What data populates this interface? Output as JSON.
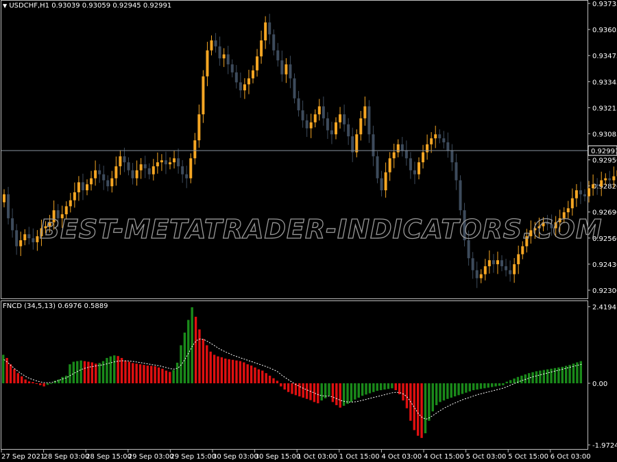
{
  "price_panel": {
    "symbol": "USDCHF,H1",
    "ohlc": [
      "0.93039",
      "0.93059",
      "0.92945",
      "0.92991"
    ],
    "current_price_label": "0.92991",
    "y_ticks": [
      "0.93735",
      "0.93605",
      "0.93475",
      "0.93345",
      "0.93215",
      "0.93085",
      "0.92950",
      "0.92820",
      "0.92690",
      "0.92560",
      "0.92430",
      "0.92300"
    ]
  },
  "indicator_panel": {
    "name": "FNCD (34,5,13)",
    "values": [
      "0.6976",
      "0.5889"
    ],
    "y_ticks": [
      "2.4194",
      "0.00",
      "-1.9724"
    ]
  },
  "time_axis": [
    "27 Sep 2021",
    "28 Sep 03:00",
    "28 Sep 15:00",
    "29 Sep 03:00",
    "29 Sep 15:00",
    "30 Sep 03:00",
    "30 Sep 15:00",
    "1 Oct 03:00",
    "1 Oct 15:00",
    "4 Oct 03:00",
    "4 Oct 15:00",
    "5 Oct 03:00",
    "5 Oct 15:00",
    "6 Oct 03:00"
  ],
  "watermark": "BEST-METATRADER-INDICATORS.COM",
  "colors": {
    "background": "#000000",
    "bull_candle": "#f5a623",
    "bear_candle": "#3d4b5c",
    "hist_up": "#1a8a1a",
    "hist_down": "#e01010",
    "signal_line": "#ffffff",
    "axis_line": "#c0c0c0",
    "price_line": "#8a94a0"
  },
  "chart_data": [
    {
      "type": "candlestick",
      "title": "USDCHF,H1",
      "ylim": [
        0.9224,
        0.9375
      ],
      "close": [
        0.9278,
        0.9266,
        0.926,
        0.9252,
        0.9255,
        0.9258,
        0.9256,
        0.9254,
        0.9257,
        0.9261,
        0.9262,
        0.9264,
        0.927,
        0.9266,
        0.9268,
        0.9272,
        0.9275,
        0.9279,
        0.9284,
        0.928,
        0.9283,
        0.9286,
        0.929,
        0.9288,
        0.9285,
        0.9282,
        0.9286,
        0.9292,
        0.9297,
        0.9294,
        0.929,
        0.9286,
        0.929,
        0.9293,
        0.9291,
        0.9288,
        0.9292,
        0.9294,
        0.9295,
        0.9293,
        0.9294,
        0.9296,
        0.9292,
        0.9288,
        0.9286,
        0.9296,
        0.9305,
        0.9318,
        0.9337,
        0.935,
        0.9355,
        0.9352,
        0.9346,
        0.9348,
        0.9343,
        0.9339,
        0.9334,
        0.933,
        0.9333,
        0.9336,
        0.934,
        0.9347,
        0.9355,
        0.9364,
        0.9358,
        0.935,
        0.9345,
        0.9338,
        0.9343,
        0.9336,
        0.9326,
        0.932,
        0.9315,
        0.9311,
        0.9314,
        0.9318,
        0.9322,
        0.9316,
        0.931,
        0.9308,
        0.9314,
        0.9318,
        0.9313,
        0.9307,
        0.9299,
        0.9308,
        0.9316,
        0.9322,
        0.9308,
        0.9297,
        0.9286,
        0.928,
        0.9289,
        0.9296,
        0.9299,
        0.9303,
        0.93,
        0.9296,
        0.929,
        0.9288,
        0.9294,
        0.9299,
        0.9303,
        0.9306,
        0.9308,
        0.9306,
        0.9304,
        0.93,
        0.9294,
        0.9285,
        0.927,
        0.9255,
        0.9246,
        0.924,
        0.9236,
        0.9238,
        0.9242,
        0.9245,
        0.9243,
        0.9245,
        0.9242,
        0.924,
        0.9238,
        0.9243,
        0.9248,
        0.9252,
        0.9257,
        0.926,
        0.9261,
        0.9262,
        0.9264,
        0.9263,
        0.9261,
        0.9264,
        0.9266,
        0.9269,
        0.9271,
        0.9276,
        0.928,
        0.9278,
        0.9277,
        0.9281,
        0.9283,
        0.9282,
        0.9285,
        0.9286,
        0.9285,
        0.9287,
        0.929,
        0.9293,
        0.9297,
        0.93,
        0.9299
      ]
    },
    {
      "type": "bar",
      "title": "FNCD (34,5,13)",
      "ylim": [
        -1.9724,
        2.4194
      ],
      "series": [
        {
          "values": [
            0.9,
            0.8,
            0.6,
            0.45,
            0.32,
            0.22,
            0.12,
            0.06,
            0.04,
            -0.02,
            -0.06,
            -0.1,
            -0.05,
            0.0,
            0.08,
            0.12,
            0.2,
            0.24,
            0.6,
            0.68,
            0.7,
            0.72,
            0.7,
            0.68,
            0.66,
            0.62,
            0.64,
            0.7,
            0.8,
            0.85,
            0.88,
            0.86,
            0.8,
            0.72,
            0.68,
            0.64,
            0.62,
            0.6,
            0.58,
            0.56,
            0.55,
            0.54,
            0.5,
            0.46,
            0.4,
            0.36,
            0.42,
            0.65,
            1.2,
            1.6,
            2.0,
            2.4,
            2.1,
            1.7,
            1.4,
            1.2,
            1.0,
            0.9,
            0.85,
            0.82,
            0.78,
            0.76,
            0.74,
            0.72,
            0.7,
            0.66,
            0.6,
            0.56,
            0.5,
            0.44,
            0.4,
            0.32,
            0.24,
            0.16,
            0.08,
            -0.1,
            -0.2,
            -0.28,
            -0.34,
            -0.38,
            -0.42,
            -0.46,
            -0.5,
            -0.54,
            -0.6,
            -0.64,
            -0.55,
            -0.48,
            -0.4,
            -0.6,
            -0.7,
            -0.78,
            -0.72,
            -0.66,
            -0.6,
            -0.52,
            -0.46,
            -0.4,
            -0.36,
            -0.32,
            -0.28,
            -0.24,
            -0.22,
            -0.2,
            -0.18,
            -0.16,
            -0.22,
            -0.35,
            -0.55,
            -0.8,
            -1.2,
            -1.5,
            -1.68,
            -1.75,
            -1.6,
            -1.2,
            -0.9,
            -0.7,
            -0.6,
            -0.55,
            -0.5,
            -0.46,
            -0.42,
            -0.38,
            -0.34,
            -0.3,
            -0.26,
            -0.22,
            -0.2,
            -0.18,
            -0.16,
            -0.14,
            -0.12,
            -0.1,
            -0.08,
            -0.06,
            0.05,
            0.1,
            0.15,
            0.2,
            0.24,
            0.28,
            0.32,
            0.35,
            0.38,
            0.4,
            0.42,
            0.44,
            0.46,
            0.48,
            0.5,
            0.52,
            0.55,
            0.58,
            0.62,
            0.66,
            0.7
          ]
        },
        {
          "values": [
            0.75,
            0.66,
            0.55,
            0.45,
            0.36,
            0.28,
            0.21,
            0.15,
            0.11,
            0.07,
            0.04,
            0.02,
            0.02,
            0.03,
            0.06,
            0.1,
            0.14,
            0.18,
            0.25,
            0.32,
            0.38,
            0.44,
            0.48,
            0.51,
            0.53,
            0.55,
            0.57,
            0.59,
            0.62,
            0.65,
            0.68,
            0.7,
            0.71,
            0.71,
            0.7,
            0.69,
            0.67,
            0.65,
            0.63,
            0.61,
            0.59,
            0.57,
            0.55,
            0.52,
            0.49,
            0.46,
            0.45,
            0.48,
            0.6,
            0.78,
            0.98,
            1.2,
            1.35,
            1.4,
            1.38,
            1.32,
            1.25,
            1.18,
            1.1,
            1.04,
            0.98,
            0.93,
            0.88,
            0.84,
            0.8,
            0.76,
            0.72,
            0.68,
            0.64,
            0.6,
            0.56,
            0.52,
            0.47,
            0.42,
            0.36,
            0.26,
            0.18,
            0.1,
            0.02,
            -0.05,
            -0.11,
            -0.17,
            -0.22,
            -0.27,
            -0.32,
            -0.37,
            -0.4,
            -0.41,
            -0.41,
            -0.45,
            -0.5,
            -0.55,
            -0.58,
            -0.6,
            -0.6,
            -0.59,
            -0.57,
            -0.54,
            -0.51,
            -0.48,
            -0.45,
            -0.42,
            -0.39,
            -0.36,
            -0.33,
            -0.3,
            -0.29,
            -0.3,
            -0.35,
            -0.45,
            -0.62,
            -0.8,
            -0.98,
            -1.1,
            -1.15,
            -1.1,
            -1.02,
            -0.94,
            -0.86,
            -0.79,
            -0.73,
            -0.67,
            -0.62,
            -0.57,
            -0.52,
            -0.48,
            -0.44,
            -0.4,
            -0.36,
            -0.33,
            -0.3,
            -0.27,
            -0.24,
            -0.21,
            -0.18,
            -0.15,
            -0.1,
            -0.05,
            0.0,
            0.05,
            0.09,
            0.13,
            0.17,
            0.21,
            0.24,
            0.27,
            0.3,
            0.33,
            0.36,
            0.39,
            0.42,
            0.45,
            0.48,
            0.51,
            0.54,
            0.57,
            0.6
          ]
        }
      ]
    }
  ]
}
